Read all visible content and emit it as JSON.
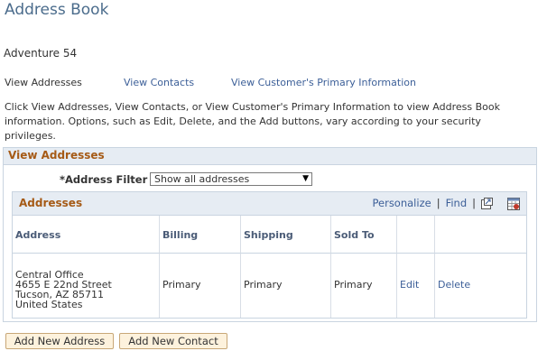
{
  "page": {
    "title": "Address Book",
    "entity": "Adventure 54"
  },
  "nav": {
    "view_addresses": "View Addresses",
    "view_contacts": "View Contacts",
    "view_primary": "View Customer's Primary Information"
  },
  "instructions": "Click View Addresses, View Contacts, or View Customer's Primary Information to view Address Book information. Options, such as Edit, Delete, and the Add buttons, vary according to your security privileges.",
  "view_box": {
    "header": "View Addresses",
    "filter_label": "*Address Filter",
    "filter_value": "Show all addresses"
  },
  "grid": {
    "title": "Addresses",
    "personalize": "Personalize",
    "find": "Find",
    "sep": "|",
    "columns": [
      "Address",
      "Billing",
      "Shipping",
      "Sold To"
    ],
    "rows": [
      {
        "address_lines": [
          "Central Office",
          "4655 E 22nd Street",
          "Tucson, AZ 85711",
          "United States"
        ],
        "billing": "Primary",
        "shipping": "Primary",
        "sold_to": "Primary",
        "edit": "Edit",
        "delete": "Delete"
      }
    ]
  },
  "buttons": {
    "add_address": "Add New Address",
    "add_contact": "Add New Contact"
  },
  "colors": {
    "title": "#4b6c8c",
    "section_header": "#a55a16",
    "link": "#3c5f98",
    "header_bg": "#e6ecf3",
    "button_bg": "#fdf2dd"
  },
  "icons": [
    "new-window-icon",
    "download-icon",
    "chevron-down-icon"
  ]
}
